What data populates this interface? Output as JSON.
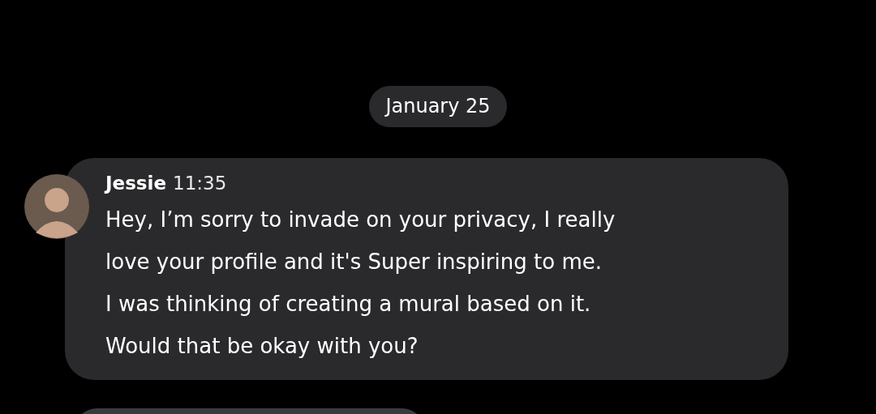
{
  "date_separator": "January 25",
  "messages": [
    {
      "sender": "Jessie",
      "time": "11:35",
      "text": "Hey, I’m sorry to invade on your privacy, I really\nlove your profile and it's Super inspiring to me.\nI was thinking of creating a mural based on it.\nWould that be okay with you?"
    }
  ]
}
